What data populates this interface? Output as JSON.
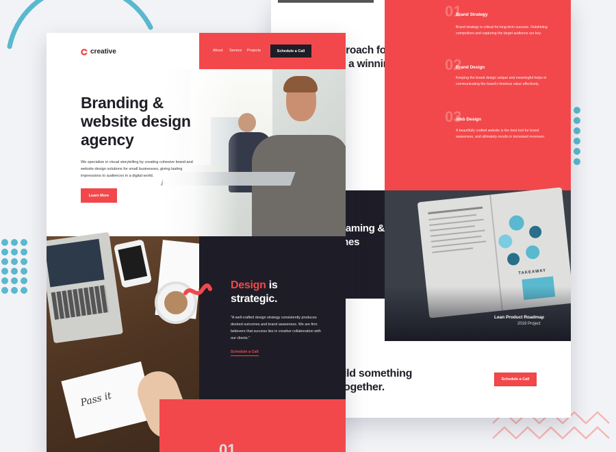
{
  "brand": {
    "name": "creative"
  },
  "nav": {
    "links": [
      "About",
      "Service",
      "Projects"
    ],
    "cta": "Schedule a Call"
  },
  "hero": {
    "title_line1": "Branding &",
    "title_line2": "website design",
    "title_line3": "agency",
    "body": "We specialize in visual storytelling by creating cohesive brand and website design solutions for small businesses, giving lasting impressions to audiences in a digital world.",
    "cta": "Learn More"
  },
  "design": {
    "title_accent": "Design",
    "title_rest": "is",
    "title_line2": "strategic.",
    "quote": "\"A well-crafted design strategy consistently produces desired outcomes and brand awareness. We are firm believers that success lies in creative collaboration with our clients.\"",
    "link": "Schedule a Call"
  },
  "bottom_number": "01",
  "back": {
    "approach_line1": "proach for",
    "approach_line2": "g a winning",
    "naming_line1": "naming &",
    "naming_line2": "mes",
    "build_line1": "ild something",
    "build_line2": "ogether.",
    "build_cta": "Schedule a Call"
  },
  "services": [
    {
      "num": "01",
      "title": "Brand Strategy",
      "text": "Brand strategy is critical for long-term success. Outshining competitors and capturing the target audience are key."
    },
    {
      "num": "02",
      "title": "Brand Design",
      "text": "Keeping the brand design unique and meaningful helps in communicating the brand's timeless value effectively."
    },
    {
      "num": "03",
      "title": "Web Design",
      "text": "A beautifully crafted website is the best tool for brand awareness, and ultimately results in increased revenues."
    }
  ],
  "project": {
    "title": "Lean Product Roadmap",
    "year": "2019 Project",
    "book_label": "TAKEAWAY"
  },
  "colors": {
    "accent": "#f2484b",
    "dark": "#1e1d27",
    "teal": "#5ab8cf"
  }
}
